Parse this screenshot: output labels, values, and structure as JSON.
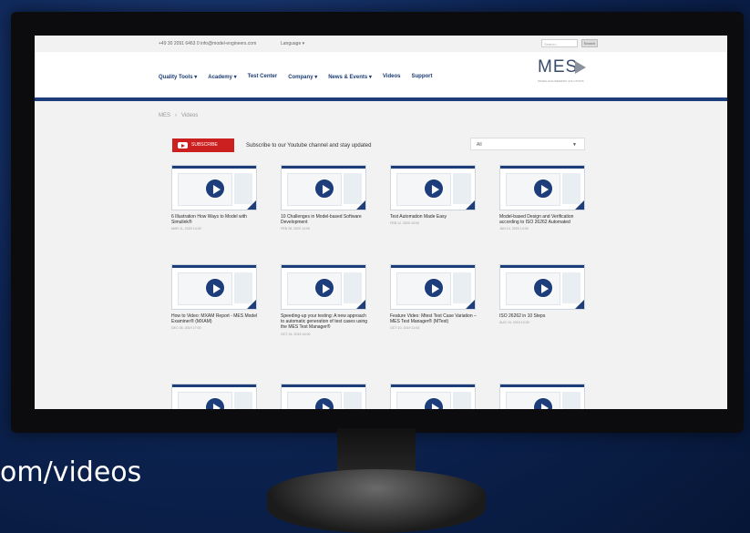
{
  "topbar": {
    "contact": "+49 30 2091 6463 0   info@model-engineers.com",
    "language": "Language ▾",
    "search_placeholder": "Search...",
    "search_button": "Search"
  },
  "nav": {
    "items": [
      "Quality Tools ▾",
      "Academy ▾",
      "Test Center",
      "Company ▾",
      "News & Events ▾",
      "Videos",
      "Support"
    ]
  },
  "logo": {
    "text": "MES",
    "sub": "MODEL ENGINEERING SOLUTIONS"
  },
  "breadcrumb": {
    "home": "MES",
    "separator": "›",
    "current": "Videos"
  },
  "subscribe": {
    "button": "SUBSCRIBE",
    "text": "Subscribe to our Youtube channel and stay updated"
  },
  "filter": {
    "selected": "All"
  },
  "videos": [
    {
      "title": "6 Illustration How Ways to Model with Simulink®",
      "date": "MAR 11, 2020 14:00"
    },
    {
      "title": "10 Challenges in Model-based Software Development",
      "date": "FEB 28, 2020 14:00"
    },
    {
      "title": "Test Automation Made Easy",
      "date": "FEB 12, 2020 15:00"
    },
    {
      "title": "Model-based Design and Verification according to ISO 26262 Automated",
      "date": "JAN 14, 2020 14:00"
    },
    {
      "title": "How to Video: MXAM Report - MES Model Examiner® (MXAM)",
      "date": "DEC 06, 2019 17:00"
    },
    {
      "title": "Speeding-up your testing: A new approach to automatic generation of test cases using the MES Test Manager®",
      "date": "OCT 24, 2019 16:00"
    },
    {
      "title": "Feature Video: Mtest Test Case Variation – MES Test Manager® (MTest)",
      "date": "OCT 10, 2019 11:04"
    },
    {
      "title": "ISO 26262 in 10 Steps",
      "date": "AUG 15, 2019 10:00"
    },
    {
      "title": "",
      "date": ""
    },
    {
      "title": "",
      "date": ""
    },
    {
      "title": "",
      "date": ""
    },
    {
      "title": "",
      "date": ""
    }
  ],
  "caption": {
    "url": "om/videos"
  },
  "colors": {
    "brand_blue": "#1d3e7b",
    "youtube_red": "#cc1f1f",
    "background": "#0d2555"
  }
}
